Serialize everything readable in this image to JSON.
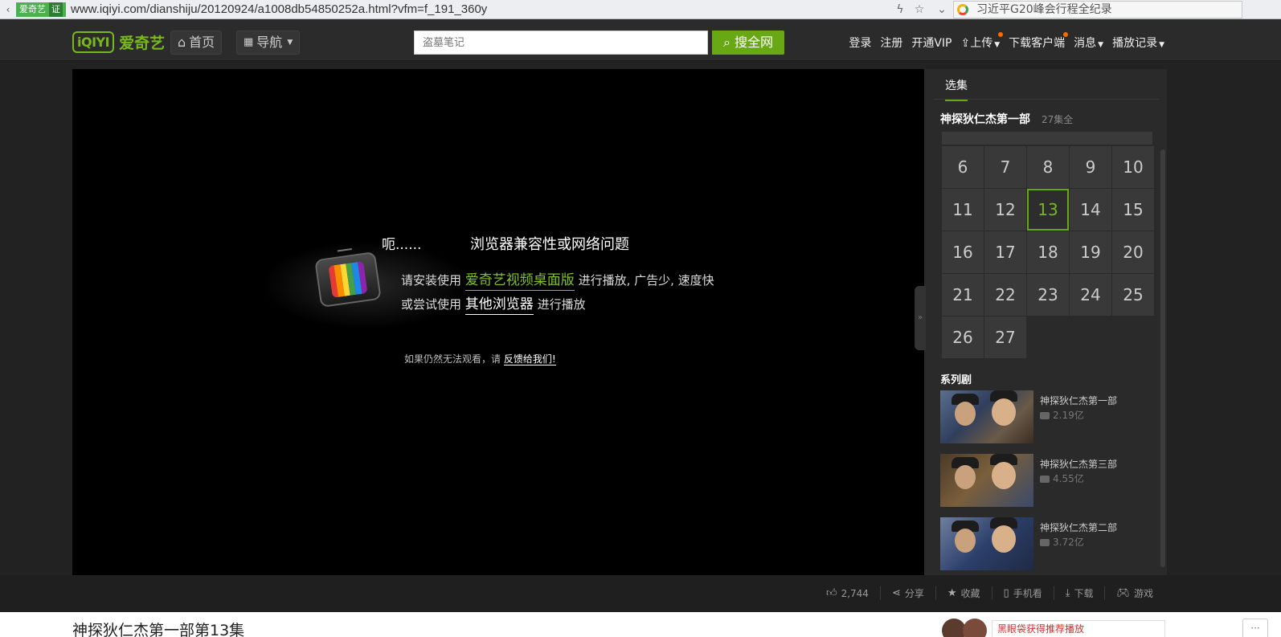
{
  "browser": {
    "site_label": "爱奇艺",
    "cert_label": "证",
    "url": "www.iqiyi.com/dianshiju/20120924/a1008db54850252a.html?vfm=f_191_360y",
    "search_query": "习近平G20峰会行程全纪录"
  },
  "header": {
    "logo_mark": "iQIYI",
    "logo_cn": "爱奇艺",
    "home_label": "首页",
    "nav_label": "导航",
    "search_placeholder": "盗墓笔记",
    "search_button": "搜全网",
    "links": {
      "login": "登录",
      "register": "注册",
      "vip": "开通VIP",
      "upload": "上传",
      "download": "下载客户端",
      "messages": "消息",
      "history": "播放记录"
    }
  },
  "player": {
    "uh": "呃......",
    "error_title": "浏览器兼容性或网络问题",
    "line1_prefix": "请安装使用",
    "line1_link": "爱奇艺视频桌面版",
    "line1_suffix": "进行播放, 广告少, 速度快",
    "line2_prefix": "或尝试使用",
    "line2_link": "其他浏览器",
    "line2_suffix": "进行播放",
    "feedback_prefix": "如果仍然无法观看，请",
    "feedback_link": "反馈给我们!"
  },
  "side": {
    "tab": "选集",
    "show_title": "神探狄仁杰第一部",
    "episode_count": "27集全",
    "episodes": [
      "6",
      "7",
      "8",
      "9",
      "10",
      "11",
      "12",
      "13",
      "14",
      "15",
      "16",
      "17",
      "18",
      "19",
      "20",
      "21",
      "22",
      "23",
      "24",
      "25",
      "26",
      "27"
    ],
    "active_episode": "13",
    "series_title": "系列剧",
    "series": [
      {
        "name": "神探狄仁杰第一部",
        "plays": "2.19亿"
      },
      {
        "name": "神探狄仁杰第三部",
        "plays": "4.55亿"
      },
      {
        "name": "神探狄仁杰第二部",
        "plays": "3.72亿"
      }
    ]
  },
  "toolbar": {
    "likes": "2,744",
    "share": "分享",
    "collect": "收藏",
    "mobile": "手机看",
    "download": "下载",
    "games": "游戏"
  },
  "bottom": {
    "page_title": "神探狄仁杰第一部第13集",
    "promo": "黑眼袋获得推荐播放"
  },
  "colors": {
    "accent": "#69a815",
    "background": "#222222",
    "player": "#000000"
  }
}
